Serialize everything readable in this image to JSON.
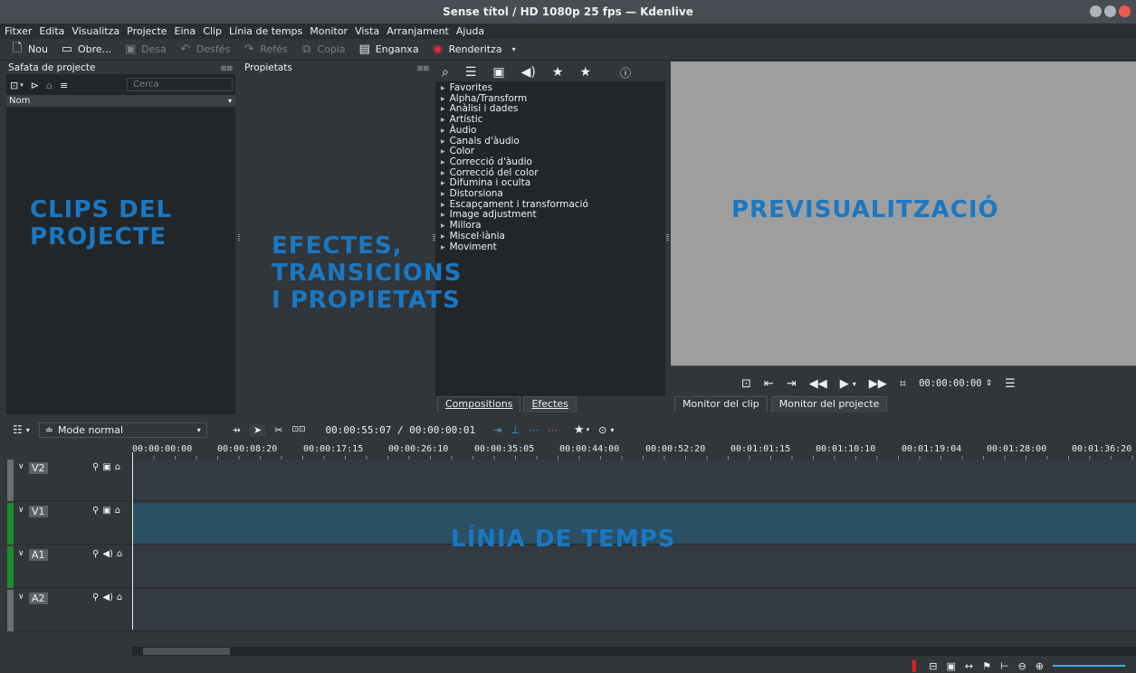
{
  "window": {
    "title": "Sense títol / HD 1080p 25 fps — Kdenlive",
    "controls": {
      "min_color": "#b0b4b8",
      "max_color": "#b0b4b8",
      "close_color": "#ea5b4c"
    }
  },
  "menu": [
    "Fitxer",
    "Edita",
    "Visualitza",
    "Projecte",
    "Eina",
    "Clip",
    "Línia de temps",
    "Monitor",
    "Vista",
    "Arranjament",
    "Ajuda"
  ],
  "toolbar": {
    "new": "Nou",
    "open": "Obre...",
    "save": "Desa",
    "undo": "Desfés",
    "redo": "Refés",
    "copy": "Copia",
    "paste": "Enganxa",
    "render": "Renderitza"
  },
  "bin": {
    "header": "Safata de projecte",
    "search_placeholder": "Cerca",
    "column": "Nom"
  },
  "properties": {
    "header": "Propietats"
  },
  "effects": {
    "categories": [
      "Favorites",
      "Alpha/Transform",
      "Anàlisi i dades",
      "Artístic",
      "Àudio",
      "Canals d'àudio",
      "Color",
      "Correcció d'àudio",
      "Correcció del color",
      "Difumina i oculta",
      "Distorsiona",
      "Escapçament i transformació",
      "Image adjustment",
      "Millora",
      "Miscel·lània",
      "Moviment"
    ],
    "tab_compositions": "Compositions",
    "tab_effects": "Efectes"
  },
  "monitor": {
    "timecode": "00:00:00:00",
    "tab_clip": "Monitor del clip",
    "tab_project": "Monitor del projecte",
    "screen_color": "#9e9e9e"
  },
  "timeline": {
    "mode": "Mode normal",
    "position": "00:00:55:07 / 00:00:00:01",
    "ruler": [
      "00:00:00:00",
      "00:00:08:20",
      "00:00:17:15",
      "00:00:26:10",
      "00:00:35:05",
      "00:00:44:00",
      "00:00:52:20",
      "00:01:01:15",
      "00:01:10:10",
      "00:01:19:04",
      "00:01:28:00",
      "00:01:36:20"
    ],
    "tracks": [
      {
        "name": "V2",
        "kind": "video",
        "bar_color": "#6a6e72"
      },
      {
        "name": "V1",
        "kind": "video",
        "bar_color": "#1e8a2a"
      },
      {
        "name": "A1",
        "kind": "audio",
        "bar_color": "#1e8a2a"
      },
      {
        "name": "A2",
        "kind": "audio",
        "bar_color": "#6a6e72"
      }
    ]
  },
  "overlays": {
    "clips": "CLIPS DEL\nPROJECTE",
    "effects": "EFECTES,\nTRANSICIONS\nI PROPIETATS",
    "preview": "PREVISUALITZACIÓ",
    "timeline": "LÍNIA DE TEMPS"
  },
  "accent_color": "#1a78c2"
}
